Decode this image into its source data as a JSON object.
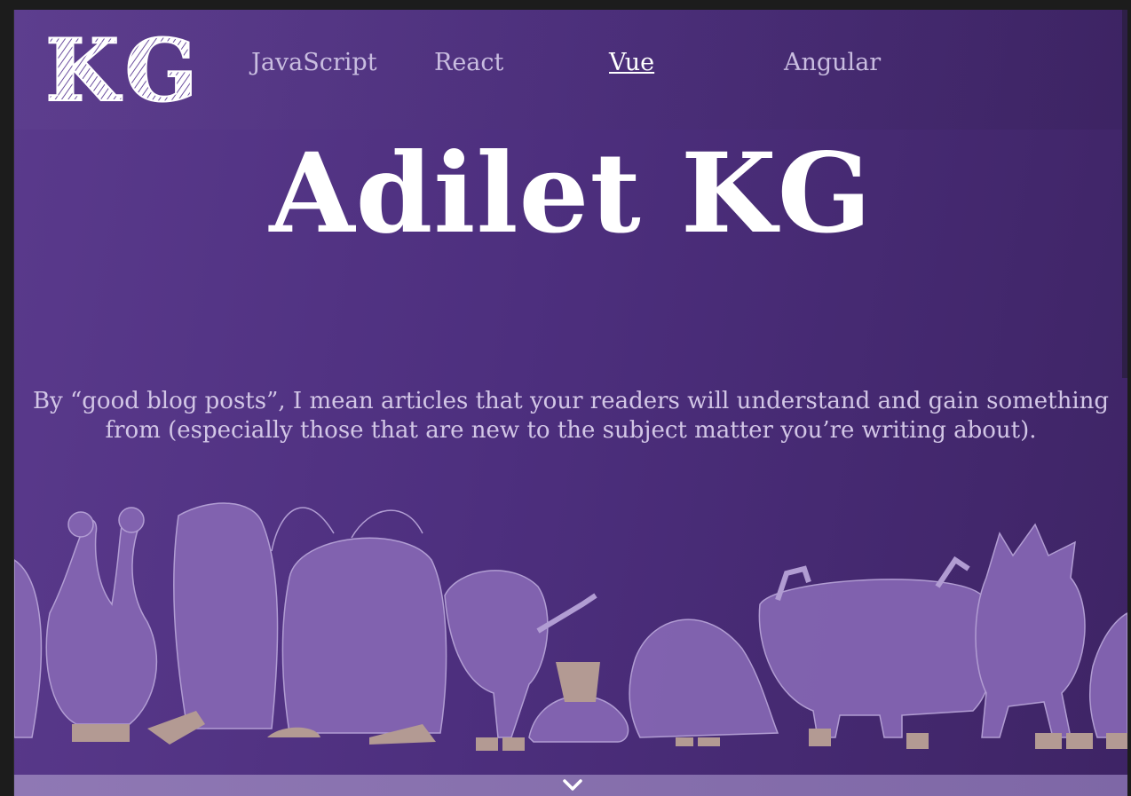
{
  "logo": {
    "text": "KG"
  },
  "nav": {
    "items": [
      {
        "label": "JavaScript",
        "active": false
      },
      {
        "label": "React",
        "active": false
      },
      {
        "label": "Vue",
        "active": true
      },
      {
        "label": "Angular",
        "active": false
      }
    ]
  },
  "hero": {
    "title": "Adilet KG",
    "tagline_line1": "By “good blog posts”, I mean articles that your readers will understand and gain something",
    "tagline_line2": "from (especially those that are new to the subject matter you’re writing about)."
  },
  "colors": {
    "background_start": "#5a3a8c",
    "background_end": "#3e2465",
    "monster_fill": "#8465b2",
    "monster_feet": "#b39a93",
    "nav_text": "#c9bde0",
    "title_text": "#ffffff"
  },
  "icons": {
    "scroll_down": "chevron-down-icon"
  }
}
